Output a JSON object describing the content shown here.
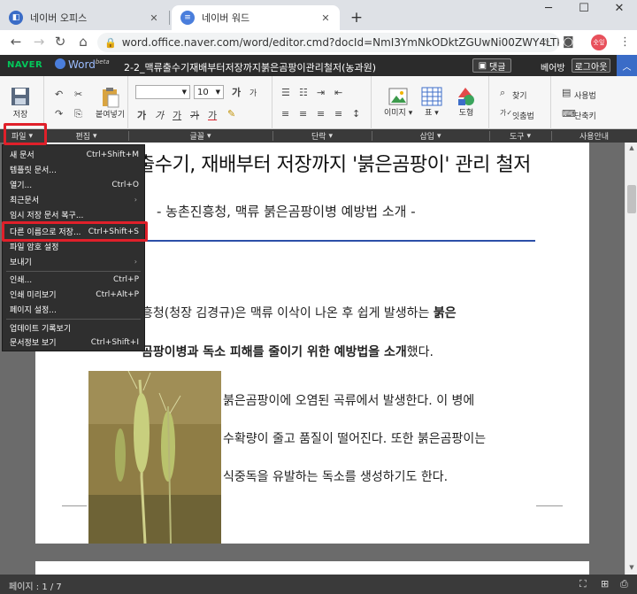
{
  "browser": {
    "tabs": [
      {
        "title": "네이버 오피스",
        "active": false
      },
      {
        "title": "네이버 워드",
        "active": true
      }
    ],
    "new_tab": "+",
    "address": "word.office.naver.com/word/editor.cmd?docId=NmI3YmNkODktZGUwNi00ZWY4LTkxNT...",
    "profile_label": "숫잎"
  },
  "app": {
    "brand": "NAVER",
    "product": "Word",
    "beta": "beta",
    "doc_title": "2-2_맥류출수기재배부터저장까지붉은곰팡이관리철저(농과원)",
    "reply_button": "댓글",
    "user_name": "베어방",
    "logout_button": "로그아웃"
  },
  "ribbon": {
    "save_label": "저장",
    "paste_label": "붙여넣기",
    "font_size": "10",
    "image_label": "이미지",
    "table_label": "표",
    "shape_label": "도형",
    "find_label": "찾기",
    "replace_label": "잇춤법",
    "help_label": "사용법",
    "shortcut_label": "단축키"
  },
  "categories": [
    "파일",
    "편집",
    "글꼴",
    "단락",
    "삽입",
    "도구",
    "사용안내"
  ],
  "file_menu": {
    "items": [
      {
        "label": "새 문서",
        "shortcut": "Ctrl+Shift+M",
        "submenu": false
      },
      {
        "label": "템플릿 문서...",
        "shortcut": "",
        "submenu": false
      },
      {
        "label": "열기...",
        "shortcut": "Ctrl+O",
        "submenu": false
      },
      {
        "label": "최근문서",
        "shortcut": "",
        "submenu": true
      },
      {
        "label": "임시 저장 문서 복구...",
        "shortcut": "",
        "submenu": false
      },
      {
        "label": "다른 이름으로 저장...",
        "shortcut": "Ctrl+Shift+S",
        "submenu": false,
        "highlighted": true
      },
      {
        "label": "파일 암호 설정",
        "shortcut": "",
        "submenu": false
      },
      {
        "label": "보내기",
        "shortcut": "",
        "submenu": true
      },
      {
        "label": "인쇄...",
        "shortcut": "Ctrl+P",
        "submenu": false
      },
      {
        "label": "인쇄 미리보기",
        "shortcut": "Ctrl+Alt+P",
        "submenu": false
      },
      {
        "label": "페이지 설정...",
        "shortcut": "",
        "submenu": false
      },
      {
        "label": "업데이트 기록보기",
        "shortcut": "",
        "submenu": false
      },
      {
        "label": "문서정보 보기",
        "shortcut": "Ctrl+Shift+I",
        "submenu": false
      }
    ]
  },
  "document": {
    "title": "출수기, 재배부터 저장까지 '붉은곰팡이' 관리 철저",
    "subtitle": "- 농촌진흥청, 맥류 붉은곰팡이병 예방법 소개 -",
    "para1_line1_plain": "흥청(청장 김경규)은 맥류 이삭이 나온 후 쉽게 발생하는 ",
    "para1_line1_bold": "붉은",
    "para1_line2_bold": "곰팡이병과 독소 피해를 줄이기 위한 예방법을 소개",
    "para1_line2_plain": "했다.",
    "para2_line1": "붉은곰팡이에 오염된 곡류에서 발생한다. 이 병에",
    "para2_line2": "수확량이 줄고 품질이 떨어진다. 또한 붉은곰팡이는",
    "para2_line3": "식중독을 유발하는 독소를 생성하기도 한다."
  },
  "status": {
    "page_indicator": "페이지 : 1 / 7"
  },
  "colors": {
    "highlight_box": "#e0202a",
    "accent_blue": "#2c4fa8",
    "naver_green": "#03c75a"
  }
}
